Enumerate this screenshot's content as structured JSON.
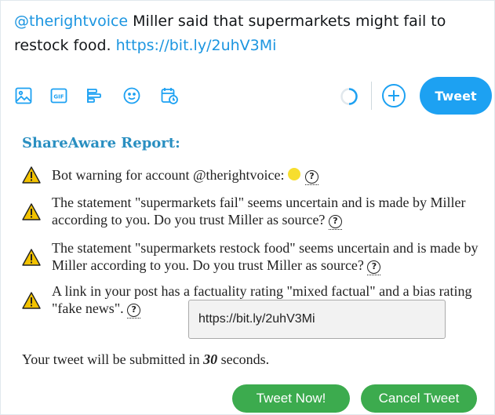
{
  "compose": {
    "mention": "@therightvoice",
    "text": " Miller said that supermarkets might fail to restock food. ",
    "link": "https://bit.ly/2uhV3Mi"
  },
  "toolbar": {
    "icons": [
      "image-icon",
      "gif-icon",
      "poll-icon",
      "emoji-icon",
      "schedule-icon"
    ],
    "tweet_label": "Tweet"
  },
  "report": {
    "title": "ShareAware Report:",
    "warnings": [
      {
        "text": "Bot warning for account @therightvoice:",
        "help": "?"
      },
      {
        "text": "The statement \"supermarkets fail\" seems uncertain and is made by Miller according to you. Do you trust Miller as source?",
        "help": "?"
      },
      {
        "text": "The statement \"supermarkets restock food\" seems uncertain and is made by Miller according to you. Do you trust Miller as source?",
        "help": "?"
      },
      {
        "text": "A link in your post has a factuality rating \"mixed factual\" and a bias rating \"fake news\".",
        "help": "?"
      }
    ],
    "tooltip": "https://bit.ly/2uhV3Mi",
    "status_color": "#f7de2e"
  },
  "submit": {
    "prefix": "Your tweet will be submitted in ",
    "seconds": "30",
    "suffix": " seconds.",
    "tweet_now": "Tweet Now!",
    "cancel": "Cancel Tweet"
  },
  "colors": {
    "accent": "#1da1f2",
    "report_title": "#2a8fc1",
    "green": "#3cab4e",
    "warning": "#f2c200"
  }
}
